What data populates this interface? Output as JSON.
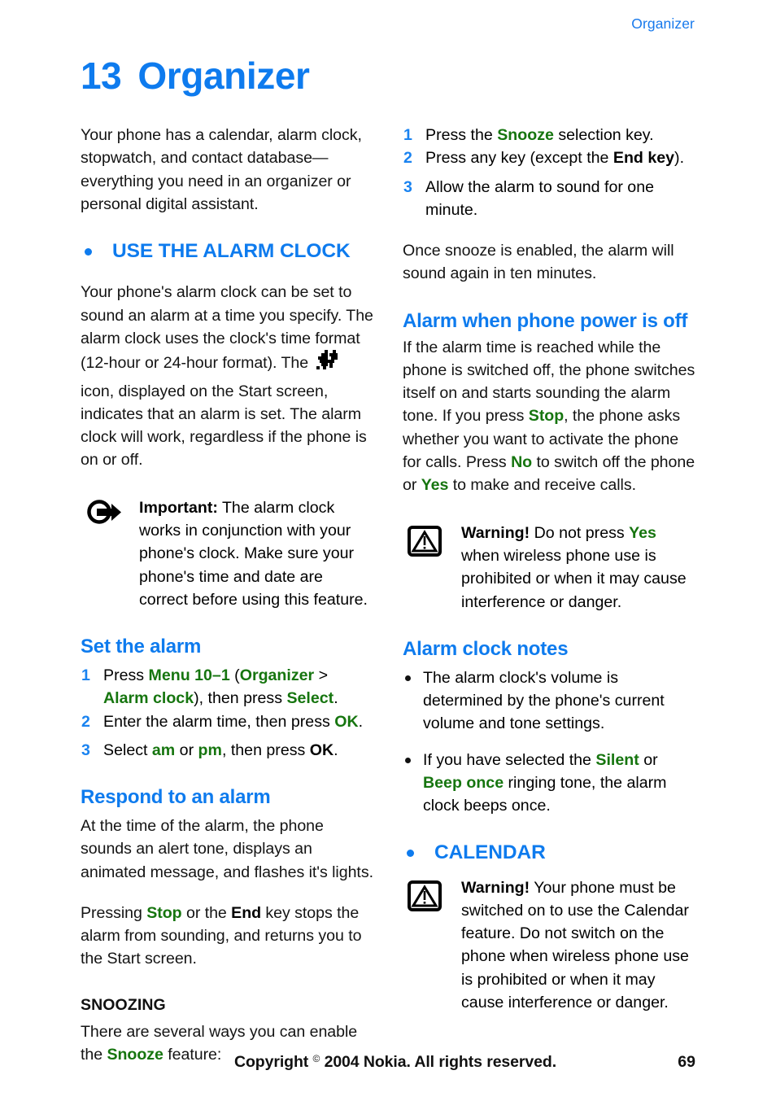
{
  "header": {
    "running_head": "Organizer"
  },
  "title": {
    "number": "13",
    "text": "Organizer"
  },
  "left_column": {
    "intro": "Your phone has a calendar, alarm clock, stopwatch, and contact database—everything you need in an organizer or personal digital assistant.",
    "section_alarm": {
      "heading": "USE THE ALARM CLOCK",
      "para_a": "Your phone's alarm clock can be set to sound an alarm at a time you specify. The alarm clock uses the clock's time format (12-hour or 24-hour format). The",
      "icon_name": "alarm-clock-bitmap-icon",
      "para_b": "icon, displayed on the Start screen, indicates that an alarm is set. The alarm clock will work, regardless if the phone is on or off.",
      "important_note": {
        "icon_name": "important-arrow-icon",
        "label": "Important:",
        "text": " The alarm clock works in conjunction with your phone's clock. Make sure your phone's time and date are correct before using this feature."
      }
    },
    "set_the_alarm": {
      "heading": "Set the alarm",
      "steps": [
        {
          "number": "1",
          "parts": [
            {
              "t": "Press ",
              "s": "plain"
            },
            {
              "t": "Menu 10–1",
              "s": "green"
            },
            {
              "t": " (",
              "s": "plain"
            },
            {
              "t": "Organizer",
              "s": "green"
            },
            {
              "t": " > ",
              "s": "plain"
            },
            {
              "t": "Alarm clock",
              "s": "green"
            },
            {
              "t": "), then press ",
              "s": "plain"
            },
            {
              "t": "Select",
              "s": "green"
            },
            {
              "t": ".",
              "s": "plain"
            }
          ]
        },
        {
          "number": "2",
          "parts": [
            {
              "t": "Enter the alarm time, then press ",
              "s": "plain"
            },
            {
              "t": "OK",
              "s": "green"
            },
            {
              "t": ".",
              "s": "plain"
            }
          ]
        },
        {
          "number": "3",
          "parts": [
            {
              "t": "Select ",
              "s": "plain"
            },
            {
              "t": "am",
              "s": "green"
            },
            {
              "t": " or ",
              "s": "plain"
            },
            {
              "t": "pm",
              "s": "green"
            },
            {
              "t": ", then press ",
              "s": "plain"
            },
            {
              "t": "OK",
              "s": "black"
            },
            {
              "t": ".",
              "s": "plain"
            }
          ]
        }
      ]
    },
    "respond_to_alarm": {
      "heading": "Respond to an alarm",
      "para_a": "At the time of the alarm, the phone sounds an alert tone, displays an animated message, and flashes it's lights.",
      "para_b_parts": [
        {
          "t": "Pressing ",
          "s": "plain"
        },
        {
          "t": "Stop",
          "s": "green"
        },
        {
          "t": " or the ",
          "s": "plain"
        },
        {
          "t": "End",
          "s": "black"
        },
        {
          "t": " key stops the alarm from sounding, and returns you to the Start screen.",
          "s": "plain"
        }
      ]
    },
    "snoozing": {
      "heading": "SNOOZING",
      "para_parts": [
        {
          "t": "There are several ways you can enable the ",
          "s": "plain"
        },
        {
          "t": "Snooze",
          "s": "green"
        },
        {
          "t": " feature:",
          "s": "plain"
        }
      ]
    }
  },
  "right_column": {
    "snooze_steps": [
      {
        "number": "1",
        "parts": [
          {
            "t": "Press the ",
            "s": "plain"
          },
          {
            "t": "Snooze",
            "s": "green"
          },
          {
            "t": " selection key.",
            "s": "plain"
          }
        ]
      },
      {
        "number": "2",
        "parts": [
          {
            "t": "Press any key (except the ",
            "s": "plain"
          },
          {
            "t": "End key",
            "s": "black"
          },
          {
            "t": ").",
            "s": "plain"
          }
        ]
      },
      {
        "number": "3",
        "parts": [
          {
            "t": "Allow the alarm to sound for one minute.",
            "s": "plain"
          }
        ]
      }
    ],
    "snooze_after": "Once snooze is enabled, the alarm will sound again in ten minutes.",
    "power_off": {
      "heading": "Alarm when phone power is off",
      "para_parts": [
        {
          "t": "If the alarm time is reached while the phone is switched off, the phone switches itself on and starts sounding the alarm tone. If you press ",
          "s": "plain"
        },
        {
          "t": "Stop",
          "s": "green"
        },
        {
          "t": ", the phone asks whether you want to activate the phone for calls. Press ",
          "s": "plain"
        },
        {
          "t": "No",
          "s": "green"
        },
        {
          "t": " to switch off the phone or ",
          "s": "plain"
        },
        {
          "t": "Yes",
          "s": "green"
        },
        {
          "t": " to make and receive calls.",
          "s": "plain"
        }
      ],
      "warning": {
        "icon_name": "warning-triangle-icon",
        "label": "Warning!",
        "parts": [
          {
            "t": " Do not press ",
            "s": "plain"
          },
          {
            "t": "Yes",
            "s": "green"
          },
          {
            "t": " when wireless phone use is prohibited or when it may cause interference or danger.",
            "s": "plain"
          }
        ]
      }
    },
    "notes": {
      "heading": "Alarm clock notes",
      "items": [
        {
          "parts": [
            {
              "t": "The alarm clock's volume is determined by the phone's current volume and tone settings.",
              "s": "plain"
            }
          ]
        },
        {
          "parts": [
            {
              "t": "If you have selected the ",
              "s": "plain"
            },
            {
              "t": "Silent",
              "s": "green"
            },
            {
              "t": " or ",
              "s": "plain"
            },
            {
              "t": "Beep once",
              "s": "green"
            },
            {
              "t": " ringing tone, the alarm clock beeps once.",
              "s": "plain"
            }
          ]
        }
      ]
    },
    "calendar": {
      "heading": "CALENDAR",
      "warning": {
        "icon_name": "warning-triangle-icon",
        "label": "Warning!",
        "text": " Your phone must be switched on to use the Calendar feature. Do not switch on the phone when wireless phone use is prohibited or when it may cause interference or danger."
      }
    }
  },
  "footer": {
    "copyright_pre": "Copyright ",
    "copyright_symbol": "©",
    "copyright_post": " 2004 Nokia. All rights reserved.",
    "page_number": "69"
  },
  "colors": {
    "heading_blue": "#0E7BEE",
    "ui_term_green": "#16750F",
    "body_black": "#141414"
  }
}
